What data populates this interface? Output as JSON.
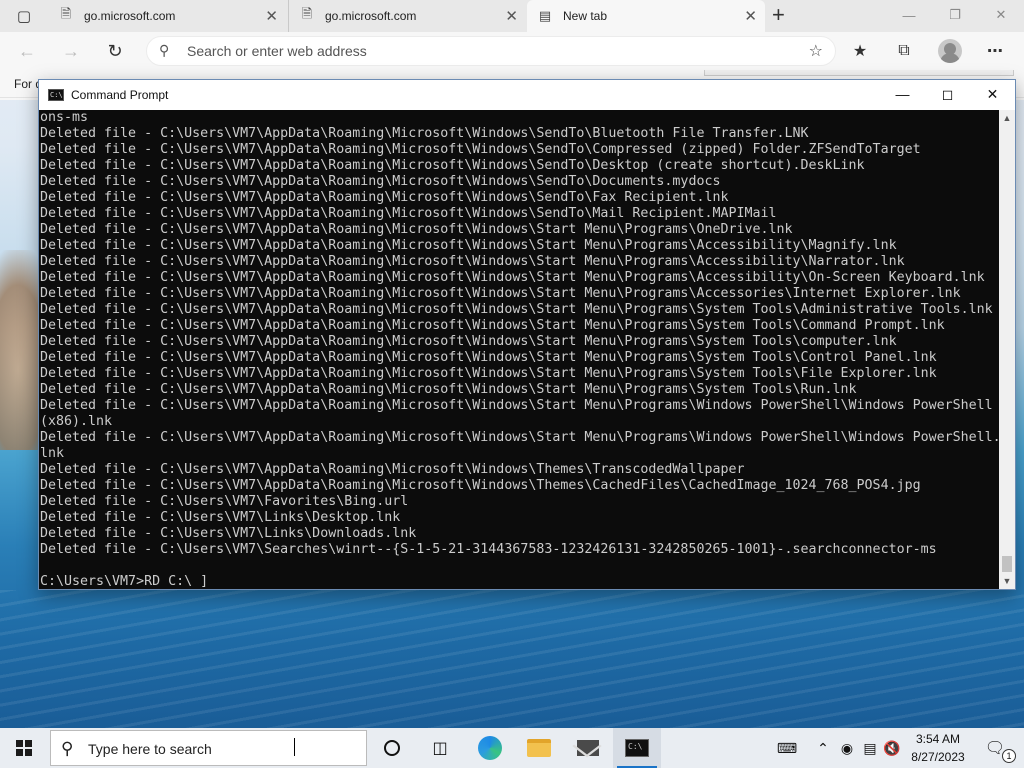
{
  "browser": {
    "tabs": [
      {
        "label": "go.microsoft.com",
        "icon": "document-icon"
      },
      {
        "label": "go.microsoft.com",
        "icon": "document-icon"
      },
      {
        "label": "New tab",
        "icon": "new-tab-icon"
      }
    ],
    "address_placeholder": "Search or enter web address",
    "favorites_bar_text": "For q"
  },
  "cmd": {
    "title": "Command Prompt",
    "lines": [
      "ons-ms",
      "Deleted file - C:\\Users\\VM7\\AppData\\Roaming\\Microsoft\\Windows\\SendTo\\Bluetooth File Transfer.LNK",
      "Deleted file - C:\\Users\\VM7\\AppData\\Roaming\\Microsoft\\Windows\\SendTo\\Compressed (zipped) Folder.ZFSendToTarget",
      "Deleted file - C:\\Users\\VM7\\AppData\\Roaming\\Microsoft\\Windows\\SendTo\\Desktop (create shortcut).DeskLink",
      "Deleted file - C:\\Users\\VM7\\AppData\\Roaming\\Microsoft\\Windows\\SendTo\\Documents.mydocs",
      "Deleted file - C:\\Users\\VM7\\AppData\\Roaming\\Microsoft\\Windows\\SendTo\\Fax Recipient.lnk",
      "Deleted file - C:\\Users\\VM7\\AppData\\Roaming\\Microsoft\\Windows\\SendTo\\Mail Recipient.MAPIMail",
      "Deleted file - C:\\Users\\VM7\\AppData\\Roaming\\Microsoft\\Windows\\Start Menu\\Programs\\OneDrive.lnk",
      "Deleted file - C:\\Users\\VM7\\AppData\\Roaming\\Microsoft\\Windows\\Start Menu\\Programs\\Accessibility\\Magnify.lnk",
      "Deleted file - C:\\Users\\VM7\\AppData\\Roaming\\Microsoft\\Windows\\Start Menu\\Programs\\Accessibility\\Narrator.lnk",
      "Deleted file - C:\\Users\\VM7\\AppData\\Roaming\\Microsoft\\Windows\\Start Menu\\Programs\\Accessibility\\On-Screen Keyboard.lnk",
      "Deleted file - C:\\Users\\VM7\\AppData\\Roaming\\Microsoft\\Windows\\Start Menu\\Programs\\Accessories\\Internet Explorer.lnk",
      "Deleted file - C:\\Users\\VM7\\AppData\\Roaming\\Microsoft\\Windows\\Start Menu\\Programs\\System Tools\\Administrative Tools.lnk",
      "Deleted file - C:\\Users\\VM7\\AppData\\Roaming\\Microsoft\\Windows\\Start Menu\\Programs\\System Tools\\Command Prompt.lnk",
      "Deleted file - C:\\Users\\VM7\\AppData\\Roaming\\Microsoft\\Windows\\Start Menu\\Programs\\System Tools\\computer.lnk",
      "Deleted file - C:\\Users\\VM7\\AppData\\Roaming\\Microsoft\\Windows\\Start Menu\\Programs\\System Tools\\Control Panel.lnk",
      "Deleted file - C:\\Users\\VM7\\AppData\\Roaming\\Microsoft\\Windows\\Start Menu\\Programs\\System Tools\\File Explorer.lnk",
      "Deleted file - C:\\Users\\VM7\\AppData\\Roaming\\Microsoft\\Windows\\Start Menu\\Programs\\System Tools\\Run.lnk",
      "Deleted file - C:\\Users\\VM7\\AppData\\Roaming\\Microsoft\\Windows\\Start Menu\\Programs\\Windows PowerShell\\Windows PowerShell",
      "(x86).lnk",
      "Deleted file - C:\\Users\\VM7\\AppData\\Roaming\\Microsoft\\Windows\\Start Menu\\Programs\\Windows PowerShell\\Windows PowerShell.",
      "lnk",
      "Deleted file - C:\\Users\\VM7\\AppData\\Roaming\\Microsoft\\Windows\\Themes\\TranscodedWallpaper",
      "Deleted file - C:\\Users\\VM7\\AppData\\Roaming\\Microsoft\\Windows\\Themes\\CachedFiles\\CachedImage_1024_768_POS4.jpg",
      "Deleted file - C:\\Users\\VM7\\Favorites\\Bing.url",
      "Deleted file - C:\\Users\\VM7\\Links\\Desktop.lnk",
      "Deleted file - C:\\Users\\VM7\\Links\\Downloads.lnk",
      "Deleted file - C:\\Users\\VM7\\Searches\\winrt--{S-1-5-21-3144367583-1232426131-3242850265-1001}-.searchconnector-ms",
      "",
      "C:\\Users\\VM7>RD C:\\ ]"
    ]
  },
  "taskbar": {
    "search_placeholder": "Type here to search",
    "time": "3:54 AM",
    "date": "8/27/2023",
    "notification_count": "1",
    "apps": [
      "cortana",
      "task-view",
      "edge",
      "file-explorer",
      "mail",
      "command-prompt"
    ],
    "active_app": "command-prompt"
  }
}
